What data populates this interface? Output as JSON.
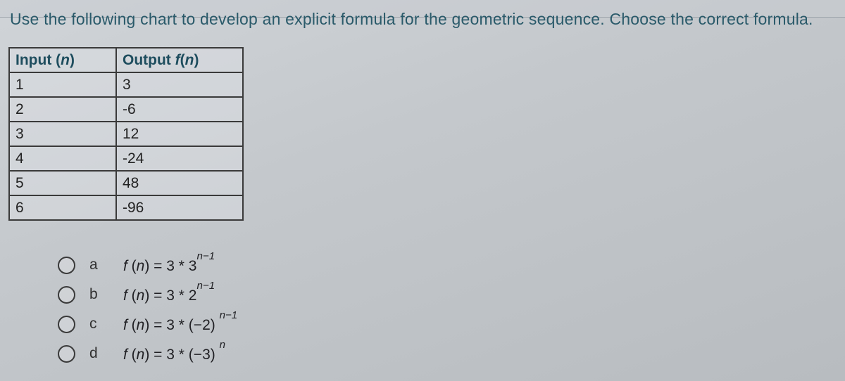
{
  "question": "Use the following chart to develop an explicit formula for the geometric sequence. Choose the correct formula.",
  "chart_data": {
    "type": "table",
    "title": "",
    "headers": {
      "input": "Input (n)",
      "output": "Output f(n)"
    },
    "rows": [
      {
        "n": "1",
        "fn": "3"
      },
      {
        "n": "2",
        "fn": "-6"
      },
      {
        "n": "3",
        "fn": "12"
      },
      {
        "n": "4",
        "fn": "-24"
      },
      {
        "n": "5",
        "fn": "48"
      },
      {
        "n": "6",
        "fn": "-96"
      }
    ]
  },
  "options": [
    {
      "letter": "a",
      "formula_html": "<span class='fn'>f</span> (<span class='fn'>n</span>) = 3 * 3<sup>n−1</sup>"
    },
    {
      "letter": "b",
      "formula_html": "<span class='fn'>f</span> (<span class='fn'>n</span>) = 3 * 2<sup>n−1</sup>"
    },
    {
      "letter": "c",
      "formula_html": "<span class='fn'>f</span> (<span class='fn'>n</span>) = 3 * (−2) <sup>n−1</sup>"
    },
    {
      "letter": "d",
      "formula_html": "<span class='fn'>f</span> (<span class='fn'>n</span>) = 3 * (−3) <sup>n</sup>"
    }
  ]
}
